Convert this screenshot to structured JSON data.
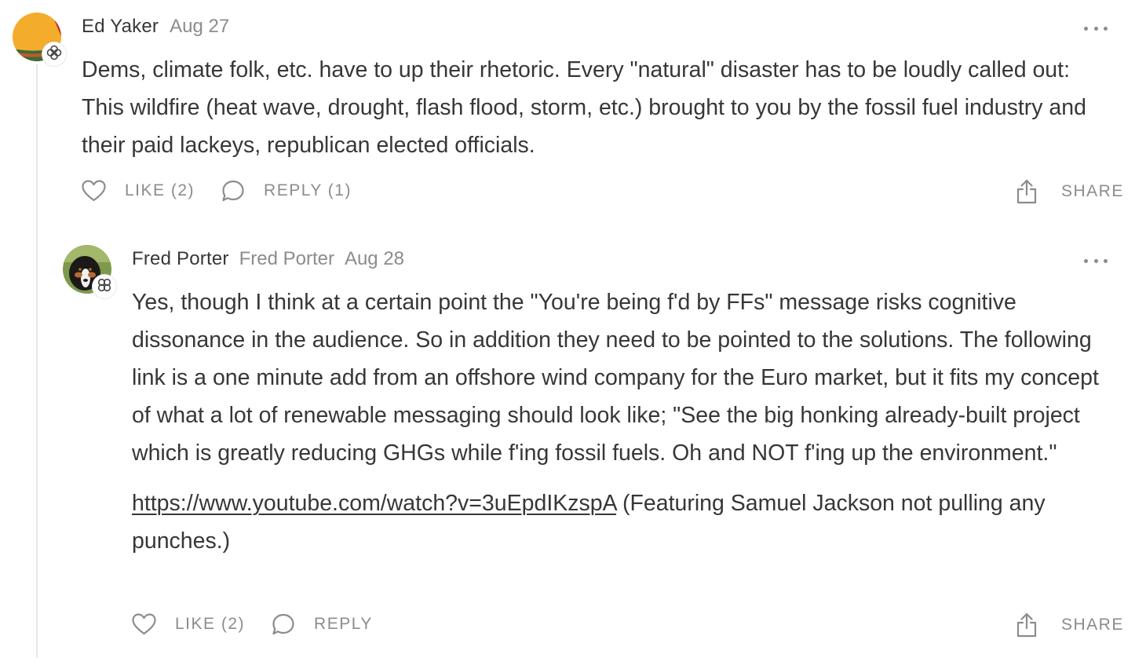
{
  "comments": [
    {
      "author": "Ed Yaker",
      "date": "Aug 27",
      "body": "Dems, climate folk, etc. have to up their rhetoric. Every \"natural\" disaster has to be loudly called out: This wildfire (heat wave, drought, flash flood, storm, etc.) brought to you by the fossil fuel industry and their paid lackeys, republican elected officials.",
      "like_label": "LIKE (2)",
      "reply_label": "REPLY (1)",
      "share_label": "SHARE"
    },
    {
      "author": "Fred Porter",
      "display_name": "Fred Porter",
      "date": "Aug 28",
      "body_paragraph_1": "Yes, though I think at a certain point the \"You're being f'd by FFs\" message risks cognitive dissonance in the audience. So in addition they need to be pointed to the solutions. The following link is a one minute add from an offshore wind company for the Euro market, but it fits my concept of what a lot of renewable messaging should look like; \"See the big honking already-built project which is greatly reducing GHGs while f'ing fossil fuels. Oh and NOT f'ing up the environment.\"",
      "link_text": "https://www.youtube.com/watch?v=3uEpdIKzspA",
      "body_paragraph_2_rest": " (Featuring Samuel Jackson not pulling any punches.)",
      "like_label": "LIKE (2)",
      "reply_label": "REPLY",
      "share_label": "SHARE"
    }
  ],
  "icons": {
    "more": "more-horizontal-icon",
    "like": "heart-icon",
    "reply": "speech-bubble-icon",
    "share": "share-upload-icon",
    "badge": "founding-member-flower-icon"
  }
}
